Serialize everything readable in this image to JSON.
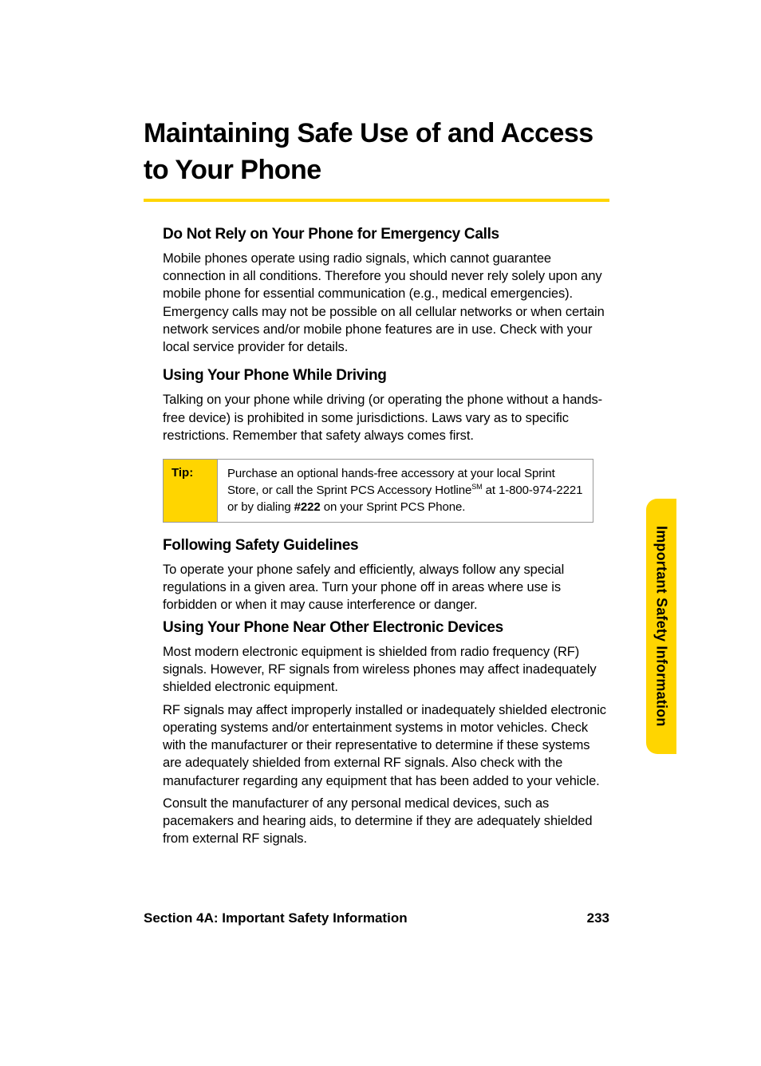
{
  "main_title": "Maintaining Safe Use of and Access to Your Phone",
  "sections": {
    "emergency": {
      "heading": "Do Not Rely on Your Phone for Emergency Calls",
      "body": "Mobile phones operate using radio signals, which cannot guarantee connection in all conditions. Therefore you should never rely solely upon any mobile phone for essential communication (e.g., medical emergencies). Emergency calls may not be possible on all cellular networks or when certain network services and/or mobile phone features are in use. Check with your local service provider for details."
    },
    "driving": {
      "heading": "Using Your Phone While Driving",
      "body": "Talking on your phone while driving (or operating the phone without a hands-free device) is prohibited in some jurisdictions. Laws vary as to specific restrictions. Remember that safety always comes first."
    },
    "guidelines": {
      "heading": "Following Safety Guidelines",
      "body": "To operate your phone safely and efficiently, always follow any special regulations in a given area. Turn your phone off in areas where use is forbidden or when it may cause interference or danger."
    },
    "electronic": {
      "heading": "Using Your Phone Near Other Electronic Devices",
      "body1": "Most modern electronic equipment is shielded from radio frequency (RF) signals. However, RF signals from wireless phones may affect inadequately shielded electronic equipment.",
      "body2": "RF signals may affect improperly installed or inadequately shielded electronic operating systems and/or entertainment systems in motor vehicles. Check with the manufacturer or their representative to determine if these systems are adequately shielded from external RF signals. Also check with the manufacturer regarding any equipment that has been added to your vehicle.",
      "body3": "Consult the manufacturer of any personal medical devices, such as pacemakers and hearing aids, to determine if they are adequately shielded from external RF signals."
    }
  },
  "tip": {
    "label": "Tip:",
    "text_part1": "Purchase an optional hands-free accessory at your local Sprint Store, or call the Sprint PCS Accessory Hotline",
    "sm": "SM",
    "text_part2": " at 1-800-974-2221 or by dialing ",
    "bold_code": "#222",
    "text_part3": " on your Sprint PCS Phone."
  },
  "side_tab": "Important Safety Information",
  "footer": {
    "section_label": "Section 4A: Important Safety Information",
    "page_number": "233"
  }
}
